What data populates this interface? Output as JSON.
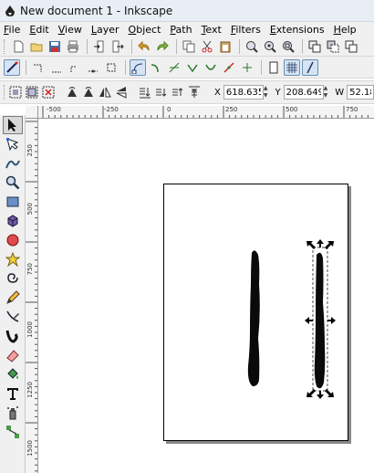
{
  "window": {
    "title": "New document 1 - Inkscape"
  },
  "menu": [
    "File",
    "Edit",
    "View",
    "Layer",
    "Object",
    "Path",
    "Text",
    "Filters",
    "Extensions",
    "Help"
  ],
  "coords": {
    "x_label": "X",
    "x_value": "618.635",
    "y_label": "Y",
    "y_value": "208.649",
    "w_label": "W",
    "w_value": "52.18"
  },
  "rulers": {
    "horizontal": [
      "-500",
      "-250",
      "0",
      "250",
      "500",
      "750"
    ],
    "vertical": [
      "250",
      "500",
      "750",
      "1000",
      "1250",
      "1500"
    ]
  },
  "tools": [
    "selector",
    "node",
    "tweak",
    "zoom",
    "rectangle",
    "3d-box",
    "ellipse",
    "star",
    "spiral",
    "pencil",
    "pen",
    "calligraphy",
    "eraser",
    "paint-bucket",
    "text",
    "spray",
    "connector"
  ]
}
